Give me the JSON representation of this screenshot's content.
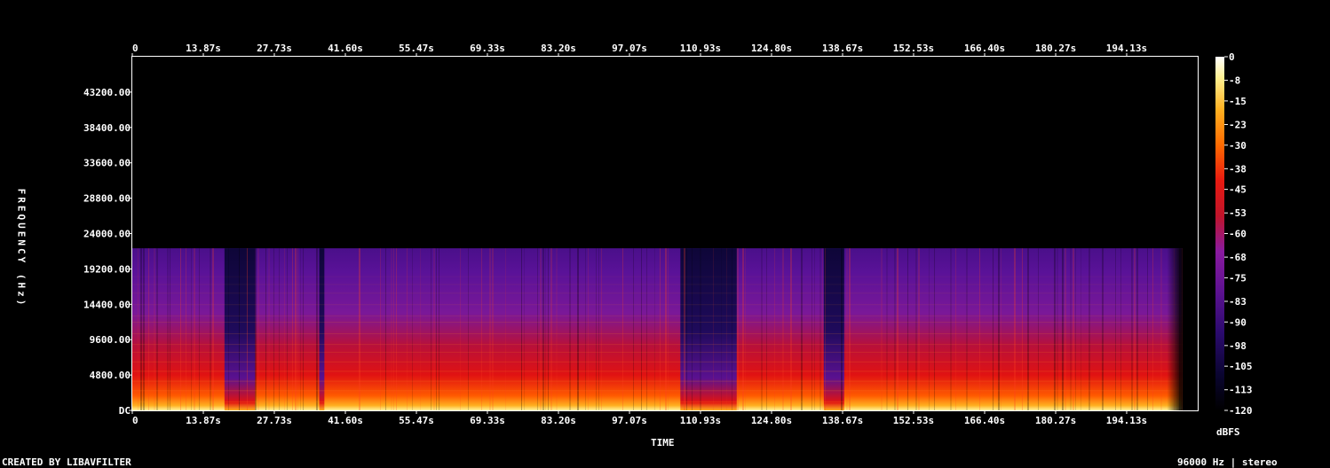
{
  "chart_data": {
    "type": "heatmap",
    "title": "",
    "xlabel": "TIME",
    "ylabel": "FREQUENCY (Hz)",
    "x_ticks": [
      "0",
      "13.87s",
      "27.73s",
      "41.60s",
      "55.47s",
      "69.33s",
      "83.20s",
      "97.07s",
      "110.93s",
      "124.80s",
      "138.67s",
      "152.53s",
      "166.40s",
      "180.27s",
      "194.13s"
    ],
    "x_tick_values": [
      0,
      13.87,
      27.73,
      41.6,
      55.47,
      69.33,
      83.2,
      97.07,
      110.93,
      124.8,
      138.67,
      152.53,
      166.4,
      180.27,
      194.13
    ],
    "xlim": [
      0,
      208
    ],
    "y_ticks": [
      "DC",
      "4800.00",
      "9600.00",
      "14400.00",
      "19200.00",
      "24000.00",
      "28800.00",
      "33600.00",
      "38400.00",
      "43200.00"
    ],
    "y_tick_values": [
      0,
      4800,
      9600,
      14400,
      19200,
      24000,
      28800,
      33600,
      38400,
      43200
    ],
    "ylim": [
      0,
      48000
    ],
    "content_cutoff_hz": 22000,
    "colorbar": {
      "unit": "dBFS",
      "ticks": [
        "0",
        "-8",
        "-15",
        "-23",
        "-30",
        "-38",
        "-45",
        "-53",
        "-60",
        "-68",
        "-75",
        "-83",
        "-90",
        "-98",
        "-105",
        "-113",
        "-120"
      ],
      "tick_values": [
        0,
        -8,
        -15,
        -23,
        -30,
        -38,
        -45,
        -53,
        -60,
        -68,
        -75,
        -83,
        -90,
        -98,
        -105,
        -113,
        -120
      ],
      "range": [
        -120,
        0
      ]
    },
    "quiet_segments_s": [
      [
        18,
        24
      ],
      [
        36.5,
        37.5
      ],
      [
        107,
        118
      ],
      [
        135,
        139
      ]
    ],
    "end_of_signal_s": 205
  },
  "footer": {
    "left": "CREATED BY LIBAVFILTER",
    "right": "96000 Hz | stereo"
  },
  "colors": {
    "background": "#000000",
    "axis": "#ffffff",
    "palette": [
      "#000000",
      "#0a0530",
      "#2b0a6e",
      "#5a1190",
      "#8a1aa0",
      "#c0142a",
      "#e81a10",
      "#ff6a00",
      "#ffb020",
      "#fff090",
      "#ffffff"
    ]
  }
}
